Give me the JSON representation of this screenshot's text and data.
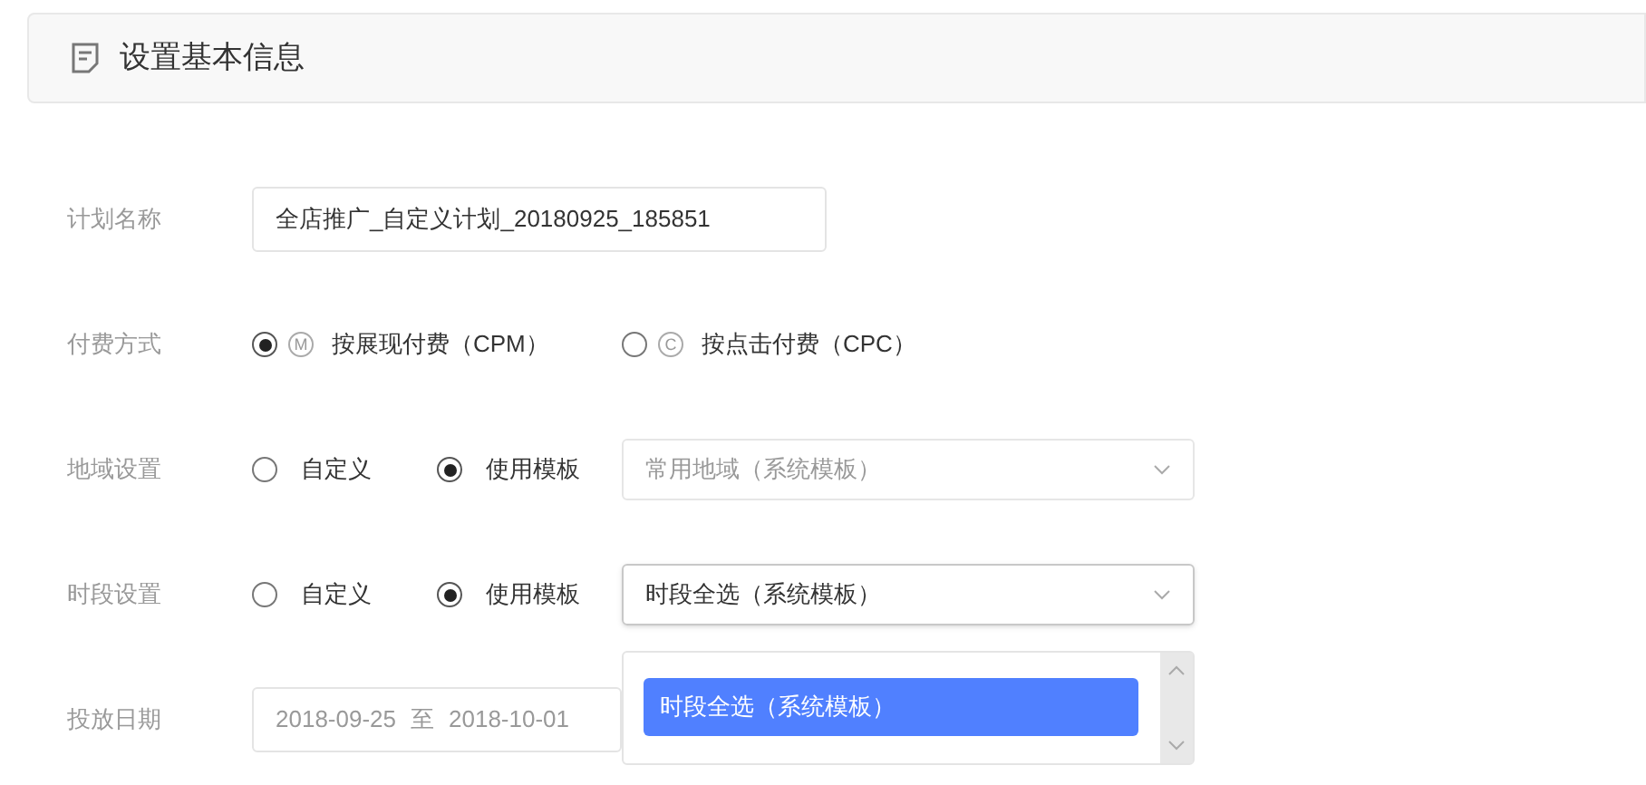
{
  "header": {
    "title": "设置基本信息"
  },
  "fields": [
    {
      "kind": "text",
      "label": "计划名称",
      "value": "全店推广_自定义计划_20180925_185851"
    },
    {
      "kind": "radio",
      "label": "付费方式",
      "options": [
        {
          "badge": "M",
          "label": "按展现付费（CPM）",
          "selected": true
        },
        {
          "badge": "C",
          "label": "按点击付费（CPC）",
          "selected": false
        }
      ]
    },
    {
      "kind": "radio_select",
      "label": "地域设置",
      "options": [
        {
          "label": "自定义",
          "selected": false
        },
        {
          "label": "使用模板",
          "selected": true
        }
      ],
      "select": {
        "value": "常用地域（系统模板）",
        "disabled": true,
        "expanded": false
      }
    },
    {
      "kind": "radio_select",
      "label": "时段设置",
      "options": [
        {
          "label": "自定义",
          "selected": false
        },
        {
          "label": "使用模板",
          "selected": true
        }
      ],
      "select": {
        "value": "时段全选（系统模板）",
        "disabled": false,
        "expanded": true,
        "menu": [
          {
            "label": "时段全选（系统模板）",
            "selected": true
          }
        ]
      }
    },
    {
      "kind": "date",
      "label": "投放日期",
      "start": "2018-09-25",
      "separator": "至",
      "end": "2018-10-01"
    }
  ]
}
